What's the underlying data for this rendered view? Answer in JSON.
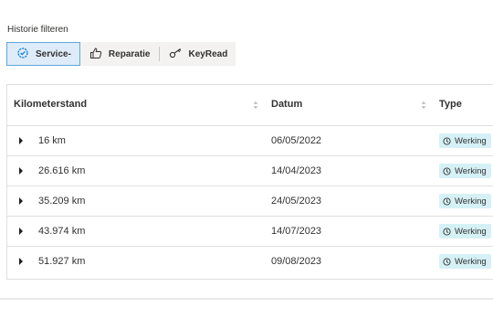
{
  "filters": {
    "label": "Historie filteren",
    "buttons": [
      {
        "label": "Service-",
        "icon": "gear-check-icon",
        "active": true
      },
      {
        "label": "Reparatie",
        "icon": "thumbs-up-icon",
        "active": false
      },
      {
        "label": "KeyRead",
        "icon": "key-icon",
        "active": false
      }
    ]
  },
  "table": {
    "columns": [
      "Kilometerstand",
      "Datum",
      "Type"
    ],
    "rows": [
      {
        "km": "16 km",
        "date": "06/05/2022",
        "type": "Werking"
      },
      {
        "km": "26.616 km",
        "date": "14/04/2023",
        "type": "Werking"
      },
      {
        "km": "35.209 km",
        "date": "24/05/2023",
        "type": "Werking"
      },
      {
        "km": "43.974 km",
        "date": "14/07/2023",
        "type": "Werking"
      },
      {
        "km": "51.927 km",
        "date": "09/08/2023",
        "type": "Werking"
      }
    ]
  },
  "colors": {
    "accent": "#0078d4",
    "active_bg": "#deecf9",
    "badge_bg": "#d5f1f6"
  }
}
